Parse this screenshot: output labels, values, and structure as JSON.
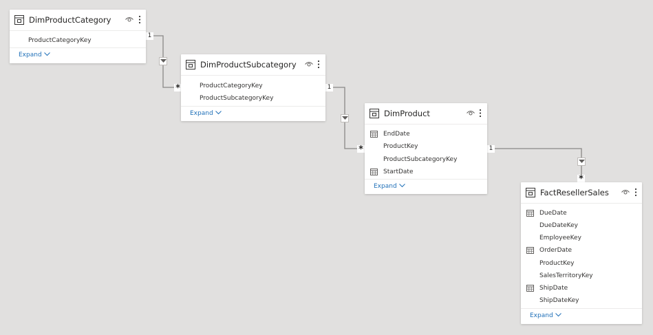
{
  "tables": [
    {
      "id": "dimproductcategory",
      "title": "DimProductCategory",
      "fields": [
        {
          "name": "ProductCategoryKey",
          "icon": ""
        }
      ],
      "expand_label": "Expand"
    },
    {
      "id": "dimproductsubcategory",
      "title": "DimProductSubcategory",
      "fields": [
        {
          "name": "ProductCategoryKey",
          "icon": ""
        },
        {
          "name": "ProductSubcategoryKey",
          "icon": ""
        }
      ],
      "expand_label": "Expand"
    },
    {
      "id": "dimproduct",
      "title": "DimProduct",
      "fields": [
        {
          "name": "EndDate",
          "icon": "calendar-icon"
        },
        {
          "name": "ProductKey",
          "icon": ""
        },
        {
          "name": "ProductSubcategoryKey",
          "icon": ""
        },
        {
          "name": "StartDate",
          "icon": "calendar-icon"
        }
      ],
      "expand_label": "Expand"
    },
    {
      "id": "factresellersales",
      "title": "FactResellerSales",
      "fields": [
        {
          "name": "DueDate",
          "icon": "calendar-icon"
        },
        {
          "name": "DueDateKey",
          "icon": ""
        },
        {
          "name": "EmployeeKey",
          "icon": ""
        },
        {
          "name": "OrderDate",
          "icon": "calendar-icon"
        },
        {
          "name": "ProductKey",
          "icon": ""
        },
        {
          "name": "SalesTerritoryKey",
          "icon": ""
        },
        {
          "name": "ShipDate",
          "icon": "calendar-icon"
        },
        {
          "name": "ShipDateKey",
          "icon": ""
        }
      ],
      "expand_label": "Expand"
    }
  ],
  "relationships": [
    {
      "from": "DimProductCategory",
      "to": "DimProductSubcategory",
      "from_cardinality": "1",
      "to_cardinality": "*"
    },
    {
      "from": "DimProductSubcategory",
      "to": "DimProduct",
      "from_cardinality": "1",
      "to_cardinality": "*"
    },
    {
      "from": "DimProduct",
      "to": "FactResellerSales",
      "from_cardinality": "1",
      "to_cardinality": "*"
    }
  ],
  "colors": {
    "canvas": "#e1e0df",
    "link_line": "#8a8886",
    "expand_link": "#1e6fb8",
    "card": "#ffffff"
  }
}
